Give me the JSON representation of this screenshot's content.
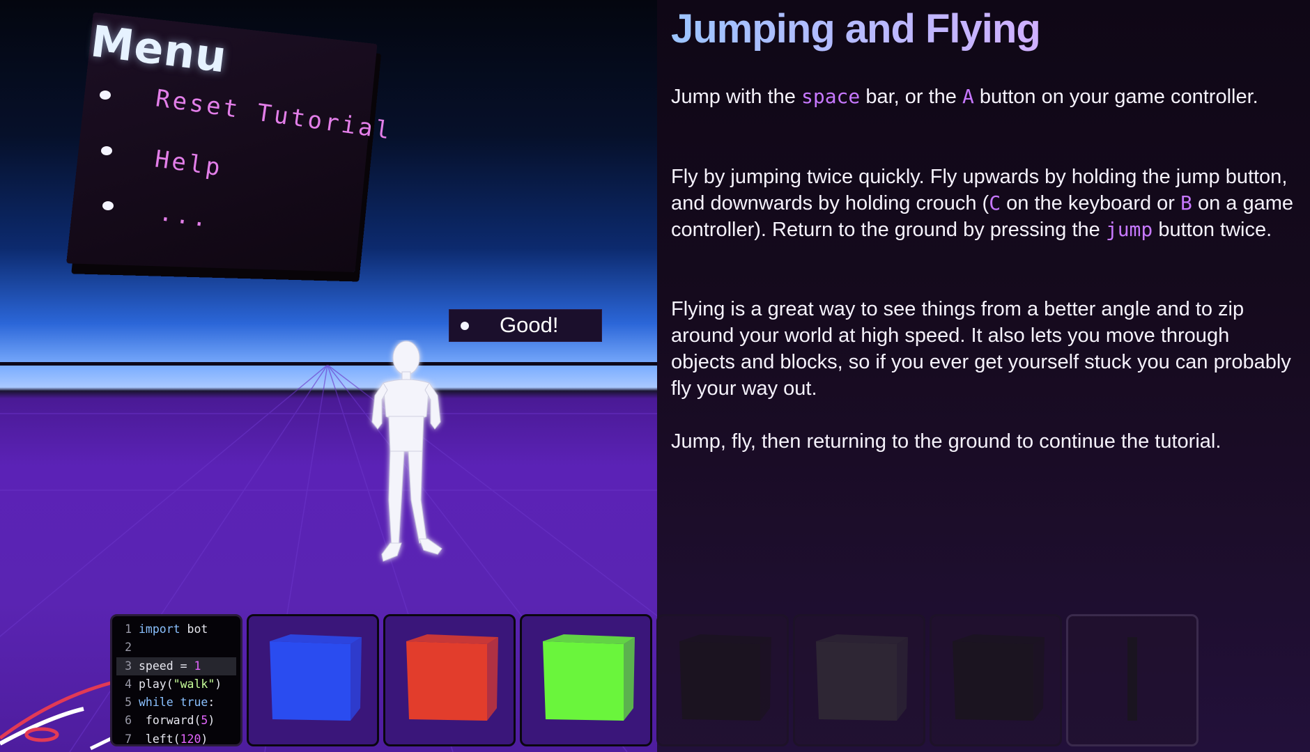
{
  "scene": {
    "menu": {
      "title": "Menu",
      "items": [
        "Reset Tutorial",
        "Help",
        "..."
      ]
    },
    "status_chip": {
      "label": "Good!"
    }
  },
  "panel": {
    "title": "Jumping and Flying",
    "p1": {
      "a": "Jump with the ",
      "space": "space",
      "b": " bar, or the ",
      "A": "A",
      "c": " button on your game controller."
    },
    "p2": {
      "a": "Fly by jumping twice quickly. Fly upwards by holding the jump button, and downwards by holding crouch (",
      "C": "C",
      "b": " on the keyboard or ",
      "B": "B",
      "c": " on a game controller). Return to the ground by pressing the ",
      "jump": "jump",
      "d": " button twice."
    },
    "p3": "Flying is a great way to see things from a better angle and to zip around your world at high speed. It also lets you move through objects and blocks, so if you ever get yourself stuck you can probably fly your way out.",
    "p4": "Jump, fly, then returning to the ground to continue the tutorial."
  },
  "hotbar": {
    "code_lines": [
      {
        "n": "1",
        "kw": "import",
        "rest": " bot"
      },
      {
        "n": "2"
      },
      {
        "n": "3",
        "plain": "speed = ",
        "num": "1"
      },
      {
        "n": "4",
        "plain": "play(",
        "str": "\"walk\"",
        "tail": ")"
      },
      {
        "n": "5",
        "kw": "while",
        "kwb": " true",
        "tail": ":"
      },
      {
        "n": "6",
        "plain": "  forward(",
        "num": "5",
        "tail": ")"
      },
      {
        "n": "7",
        "plain": "  left(",
        "num": "120",
        "tail": ")"
      }
    ],
    "blocks": [
      {
        "name": "blue-block",
        "color": "#2a4cf0"
      },
      {
        "name": "red-block",
        "color": "#e23d2c"
      },
      {
        "name": "green-block",
        "color": "#6af53c"
      },
      {
        "name": "empty-block",
        "color": "#1b1320"
      },
      {
        "name": "gray-block",
        "color": "#2e2634"
      },
      {
        "name": "empty-block",
        "color": "#1b1420"
      },
      {
        "name": "character-item",
        "color": "#1a1420"
      }
    ]
  },
  "colors": {
    "accent_code": "#c778ff",
    "title_start": "#9cc4ff",
    "title_end": "#d0b0ff"
  }
}
